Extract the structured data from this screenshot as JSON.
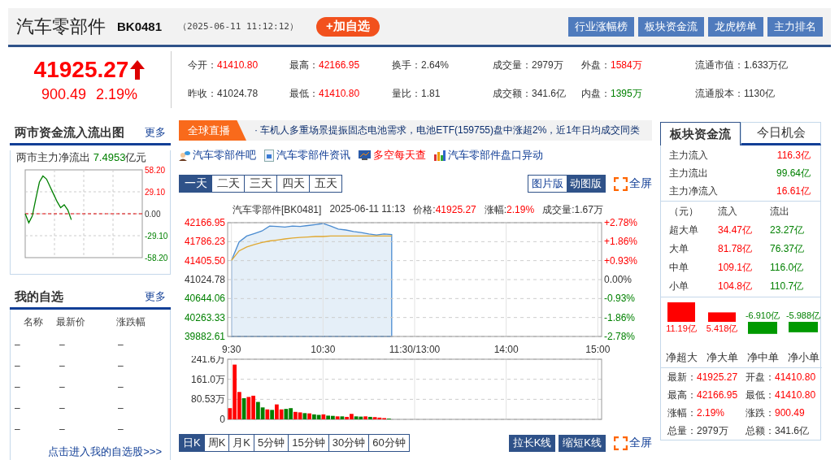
{
  "header": {
    "title": "汽车零部件",
    "code": "BK0481",
    "time": "（2025-06-11 11:12:12）",
    "add_button": "+加自选",
    "nav_buttons": [
      "行业涨幅榜",
      "板块资金流",
      "龙虎榜单",
      "主力排名"
    ]
  },
  "quote": {
    "price": "41925.27",
    "rising": true,
    "change": "900.49",
    "change_pct": "2.19%",
    "stats": [
      {
        "label": "今开：",
        "value": "41410.80",
        "color": "#ff0000"
      },
      {
        "label": "最高：",
        "value": "42166.95",
        "color": "#ff0000"
      },
      {
        "label": "换手：",
        "value": "2.64%",
        "color": "#333333"
      },
      {
        "label": "成交量：",
        "value": "2979万",
        "color": "#333333"
      },
      {
        "label": "外盘：",
        "value": "1584万",
        "color": "#ff0000"
      },
      {
        "label": "流通市值：",
        "value": "1.633万亿",
        "color": "#333333"
      },
      {
        "label": "昨收：",
        "value": "41024.78",
        "color": "#333333"
      },
      {
        "label": "最低：",
        "value": "41410.80",
        "color": "#ff0000"
      },
      {
        "label": "量比：",
        "value": "1.81",
        "color": "#333333"
      },
      {
        "label": "成交额：",
        "value": "341.6亿",
        "color": "#333333"
      },
      {
        "label": "内盘：",
        "value": "1395万",
        "color": "#008000"
      },
      {
        "label": "流通股本：",
        "value": "1130亿",
        "color": "#333333"
      }
    ]
  },
  "market_flow": {
    "title": "两市资金流入流出图",
    "more": "更多",
    "net_label": "两市主力净流出",
    "net_value": "7.4953",
    "unit": "亿元",
    "chart_data": {
      "type": "line",
      "grid": true,
      "ylim": [
        -58.2,
        58.2
      ],
      "yticks": [
        {
          "value": 58.2,
          "label": "58.20"
        },
        {
          "value": 29.1,
          "label": "29.10"
        },
        {
          "value": 0,
          "label": "0.00"
        },
        {
          "value": -29.1,
          "label": "-29.10"
        },
        {
          "value": -58.2,
          "label": "-58.20"
        }
      ],
      "series": [
        {
          "color": "#dd0000",
          "line_style": "dashed",
          "values": [
            0,
            0,
            0,
            0,
            0,
            0,
            0,
            0,
            0,
            0,
            0,
            0,
            0,
            0,
            0,
            0,
            0,
            0,
            0,
            0,
            0,
            0,
            0,
            0,
            0,
            0,
            0,
            0,
            0,
            0,
            0,
            0,
            0,
            0
          ]
        },
        {
          "color": "#008000",
          "line_style": "solid",
          "values": [
            0,
            -12,
            -3,
            20,
            42,
            50,
            46,
            36,
            26,
            16,
            8,
            12,
            5,
            -8,
            null,
            null,
            null,
            null,
            null,
            null,
            null,
            null,
            null,
            null,
            null,
            null,
            null,
            null,
            null,
            null,
            null,
            null,
            null,
            null
          ]
        }
      ]
    }
  },
  "watchlist": {
    "title": "我的自选",
    "more": "更多",
    "columns": [
      "名称",
      "最新价",
      "涨跌幅"
    ],
    "rows": [
      [
        "–",
        "–",
        "–"
      ],
      [
        "–",
        "–",
        "–"
      ],
      [
        "–",
        "–",
        "–"
      ],
      [
        "–",
        "–",
        "–"
      ],
      [
        "–",
        "–",
        "–"
      ]
    ],
    "link": "点击进入我的自选股>>>"
  },
  "news": {
    "tag": "全球直播",
    "text": "· 车机人多重场景提振固态电池需求，电池ETF(159755)盘中涨超2%，近1年日均成交同类"
  },
  "links": [
    {
      "label": "汽车零部件吧",
      "kind": "forum",
      "highlight": false
    },
    {
      "label": "汽车零部件资讯",
      "kind": "news",
      "highlight": false
    },
    {
      "label": "多空每天查",
      "kind": "monitor",
      "highlight": true
    },
    {
      "label": "汽车零部件盘口异动",
      "kind": "bars",
      "highlight": false
    }
  ],
  "range_tabs": [
    {
      "label": "一天",
      "selected": true
    },
    {
      "label": "二天",
      "selected": false
    },
    {
      "label": "三天",
      "selected": false
    },
    {
      "label": "四天",
      "selected": false
    },
    {
      "label": "五天",
      "selected": false
    }
  ],
  "view_tabs": [
    {
      "label": "图片版",
      "selected": false
    },
    {
      "label": "动图版",
      "selected": true
    }
  ],
  "fullscreen": "全屏",
  "intraday": {
    "title": "汽车零部件[BK0481]",
    "time": "2025-06-11 11:13",
    "fields": [
      {
        "label": "价格:",
        "value": "41925.27",
        "color": "#ff0000"
      },
      {
        "label": "涨幅:",
        "value": "2.19%",
        "color": "#ff0000"
      },
      {
        "label": "成交量:",
        "value": "1.67万",
        "color": "#333333"
      }
    ],
    "pct_ticks": [
      "+2.78%",
      "+1.86%",
      "+0.93%",
      "0.00%",
      "-0.93%",
      "-1.86%",
      "-2.78%"
    ],
    "chart_data": {
      "type": "line",
      "grid": true,
      "ylim": [
        39882.61,
        42166.95
      ],
      "categories": [
        "9:30",
        null,
        null,
        null,
        null,
        null,
        null,
        null,
        null,
        null,
        null,
        null,
        "10:30",
        null,
        null,
        null,
        null,
        null,
        null,
        null,
        null,
        null,
        null,
        null,
        "11:30/13:00",
        null,
        null,
        null,
        null,
        null,
        null,
        null,
        null,
        null,
        null,
        null,
        "14:00",
        null,
        null,
        null,
        null,
        null,
        null,
        null,
        null,
        null,
        null,
        null,
        "15:00"
      ],
      "yticks": [
        {
          "value": 42166.95,
          "label": "42166.95"
        },
        {
          "value": 41786.23,
          "label": "41786.23"
        },
        {
          "value": 41405.5,
          "label": "41405.50"
        },
        {
          "value": 41024.78,
          "label": "41024.78"
        },
        {
          "value": 40644.06,
          "label": "40644.06"
        },
        {
          "value": 40263.33,
          "label": "40263.33"
        },
        {
          "value": 39882.61,
          "label": "39882.61"
        }
      ],
      "series": [
        {
          "type": "area",
          "color": "#4a8bd0",
          "values": [
            41410,
            41780,
            41900,
            41950,
            42000,
            42100,
            42090,
            42080,
            42100,
            42090,
            42110,
            42130,
            42150,
            42100,
            42040,
            42020,
            41990,
            41970,
            41940,
            41920,
            41940,
            41930,
            null,
            null,
            null,
            null,
            null,
            null,
            null,
            null,
            null,
            null,
            null,
            null,
            null,
            null,
            null,
            null,
            null,
            null,
            null,
            null,
            null,
            null,
            null,
            null,
            null,
            null,
            null
          ]
        },
        {
          "type": "line",
          "color": "#e0a830",
          "values": [
            41410,
            41600,
            41680,
            41730,
            41770,
            41800,
            41820,
            41840,
            41860,
            41870,
            41880,
            41890,
            41890,
            41900,
            41900,
            41900,
            41900,
            41900,
            41900,
            41900,
            41900,
            41900,
            null,
            null,
            null,
            null,
            null,
            null,
            null,
            null,
            null,
            null,
            null,
            null,
            null,
            null,
            null,
            null,
            null,
            null,
            null,
            null,
            null,
            null,
            null,
            null,
            null,
            null,
            null
          ]
        }
      ]
    }
  },
  "volume": {
    "chart_data": {
      "type": "bar",
      "grid": true,
      "ylim": [
        0,
        241.6
      ],
      "yticks": [
        {
          "value": 241.6,
          "label": "241.6万"
        },
        {
          "value": 161.0,
          "label": "161.0万"
        },
        {
          "value": 80.53,
          "label": "80.53万"
        },
        {
          "value": 0,
          "label": "0"
        }
      ],
      "categories": [
        null,
        null,
        null,
        null,
        null,
        null,
        null,
        null,
        null,
        null,
        null,
        null,
        null,
        null,
        null,
        null,
        null,
        null,
        null,
        null,
        null,
        null,
        null,
        null,
        null,
        null,
        null,
        null,
        null,
        null,
        null,
        null,
        null,
        null,
        null,
        null,
        null,
        null,
        null,
        null,
        null,
        null,
        null,
        null,
        null,
        null,
        null,
        null,
        null,
        null,
        null,
        null,
        null,
        null,
        null,
        null,
        null,
        null,
        null,
        null,
        null,
        null,
        null,
        null,
        null,
        null,
        null,
        null,
        null,
        null,
        null,
        null,
        null,
        null,
        null,
        null,
        null,
        null,
        null,
        null
      ],
      "series": [
        {
          "color": "#ff0000",
          "values": [
            45,
            220,
            110,
            null,
            90,
            95,
            null,
            null,
            40,
            null,
            60,
            40,
            null,
            null,
            30,
            28,
            null,
            24,
            null,
            null,
            20,
            null,
            null,
            12,
            null,
            10,
            22,
            null,
            null,
            12,
            null,
            9,
            7,
            5,
            null,
            null,
            null,
            null,
            null,
            null,
            null,
            null,
            null,
            null,
            null,
            null,
            null,
            null,
            null,
            null,
            null,
            null,
            null,
            null,
            null,
            null,
            null,
            null,
            null,
            null,
            null,
            null,
            null,
            null,
            null,
            null,
            null,
            null,
            null,
            null,
            null,
            null,
            null,
            null,
            null,
            null,
            null,
            null,
            null,
            null
          ]
        },
        {
          "color": "#008000",
          "values": [
            null,
            null,
            null,
            85,
            null,
            null,
            70,
            48,
            null,
            38,
            null,
            null,
            42,
            45,
            null,
            null,
            25,
            null,
            20,
            18,
            null,
            15,
            14,
            null,
            12,
            null,
            null,
            12,
            11,
            null,
            10,
            null,
            null,
            null,
            3,
            null,
            null,
            null,
            null,
            null,
            null,
            null,
            null,
            null,
            null,
            null,
            null,
            null,
            null,
            null,
            null,
            null,
            null,
            null,
            null,
            null,
            null,
            null,
            null,
            null,
            null,
            null,
            null,
            null,
            null,
            null,
            null,
            null,
            null,
            null,
            null,
            null,
            null,
            null,
            null,
            null,
            null,
            null,
            null,
            null
          ]
        }
      ]
    }
  },
  "kline_tabs": [
    {
      "label": "日K",
      "selected": true
    },
    {
      "label": "周K",
      "selected": false
    },
    {
      "label": "月K",
      "selected": false
    },
    {
      "label": "5分钟",
      "selected": false
    },
    {
      "label": "15分钟",
      "selected": false
    },
    {
      "label": "30分钟",
      "selected": false
    },
    {
      "label": "60分钟",
      "selected": false
    }
  ],
  "kline_buttons": [
    "拉长K线",
    "缩短K线"
  ],
  "kline_fullscreen": "全屏",
  "side_tabs": [
    {
      "label": "板块资金流",
      "selected": true
    },
    {
      "label": "今日机会",
      "selected": false
    }
  ],
  "main_flow": [
    {
      "label": "主力流入",
      "value": "116.3亿",
      "color": "#ff0000"
    },
    {
      "label": "主力流出",
      "value": "99.64亿",
      "color": "#008000"
    },
    {
      "label": "主力净流入",
      "value": "16.61亿",
      "color": "#ff0000"
    }
  ],
  "order_table": {
    "columns": [
      "（元）",
      "流入",
      "流出"
    ],
    "rows": [
      {
        "label": "超大单",
        "inflow": "34.47亿",
        "outflow": "23.27亿"
      },
      {
        "label": "大单",
        "inflow": "81.78亿",
        "outflow": "76.37亿"
      },
      {
        "label": "中单",
        "inflow": "109.1亿",
        "outflow": "116.0亿"
      },
      {
        "label": "小单",
        "inflow": "104.8亿",
        "outflow": "110.7亿"
      }
    ]
  },
  "net_flow": {
    "chart_data": {
      "type": "bar",
      "categories": [
        "净超大",
        "净大单",
        "净中单",
        "净小单"
      ],
      "values": [
        11.19,
        5.418,
        -6.91,
        -5.988
      ],
      "value_labels": [
        "11.19亿",
        "5.418亿",
        "-6.910亿",
        "-5.988亿"
      ]
    }
  },
  "summary": [
    {
      "label": "最新：",
      "value": "41925.27",
      "color": "#ff0000"
    },
    {
      "label": "开盘：",
      "value": "41410.80",
      "color": "#ff0000"
    },
    {
      "label": "最高：",
      "value": "42166.95",
      "color": "#ff0000"
    },
    {
      "label": "最低：",
      "value": "41410.80",
      "color": "#ff0000"
    },
    {
      "label": "涨幅：",
      "value": "2.19%",
      "color": "#ff0000"
    },
    {
      "label": "涨跌：",
      "value": "900.49",
      "color": "#ff0000"
    },
    {
      "label": "总量：",
      "value": "2979万",
      "color": "#333333"
    },
    {
      "label": "总额：",
      "value": "341.6亿",
      "color": "#333333"
    }
  ]
}
